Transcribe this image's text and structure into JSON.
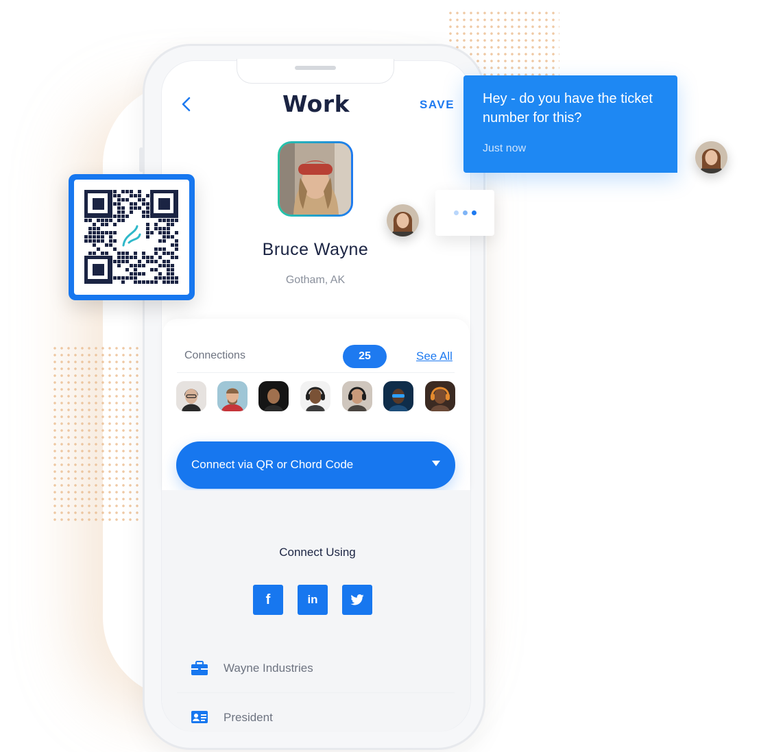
{
  "header": {
    "title": "Work",
    "save_label": "SAVE",
    "back_icon": "chevron-left-icon"
  },
  "profile": {
    "name": "Bruce Wayne",
    "location": "Gotham, AK"
  },
  "connections": {
    "label": "Connections",
    "count": "25",
    "see_all": "See All",
    "avatar_count": 7
  },
  "cta": {
    "label": "Connect via QR or Chord Code",
    "icon": "caret-down-icon"
  },
  "connect_using": {
    "label": "Connect Using",
    "networks": [
      {
        "name": "facebook",
        "glyph": "f"
      },
      {
        "name": "linkedin",
        "glyph": "in"
      },
      {
        "name": "twitter",
        "glyph": "twitter-bird-icon"
      }
    ]
  },
  "details": [
    {
      "icon": "briefcase-icon",
      "text": "Wayne Industries"
    },
    {
      "icon": "id-card-icon",
      "text": "President"
    }
  ],
  "chat": {
    "message": "Hey - do you have the ticket number for this?",
    "time": "Just now"
  },
  "colors": {
    "accent": "#1777ef",
    "chat": "#1e88f3",
    "dark": "#1b2443",
    "dots": "#efc9a4"
  }
}
